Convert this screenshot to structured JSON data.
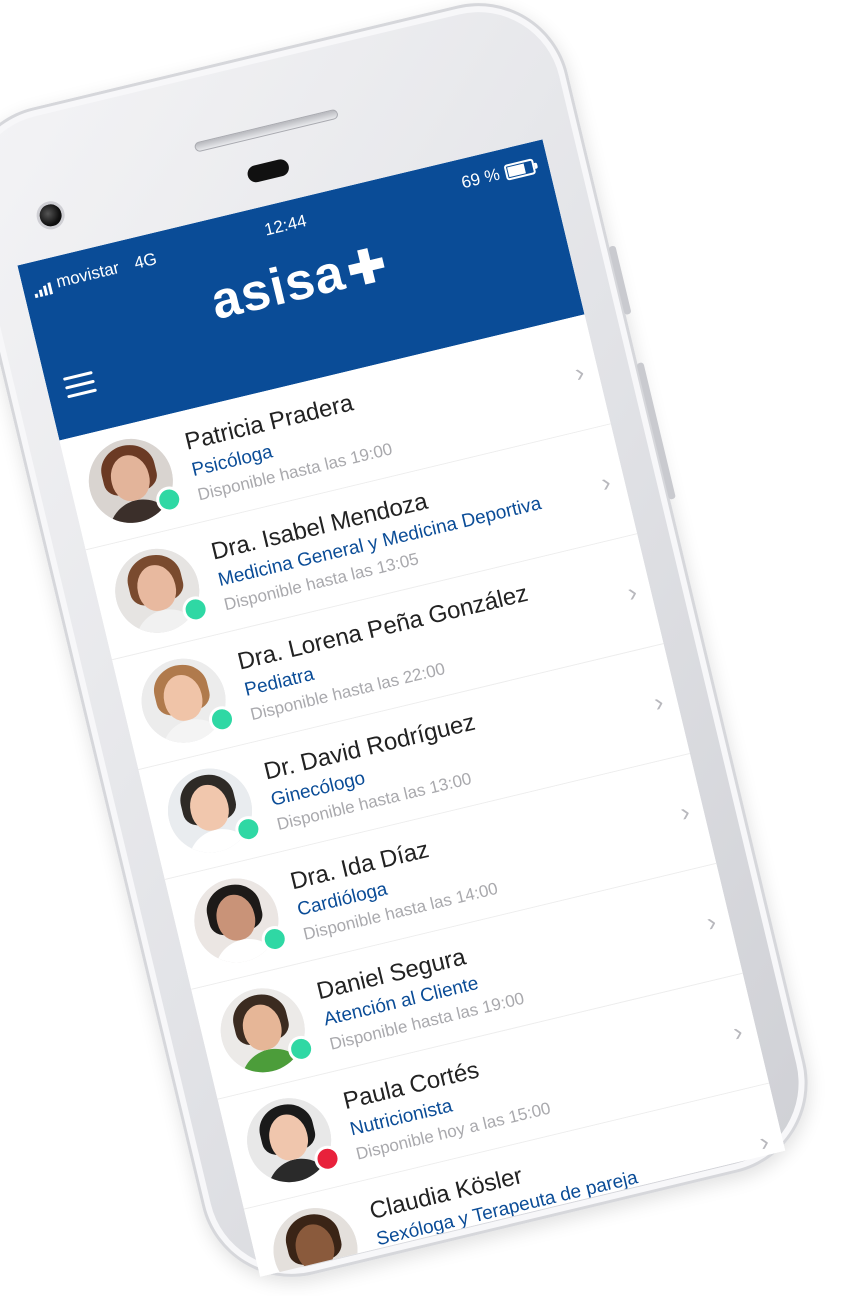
{
  "status_bar": {
    "carrier": "movistar",
    "network": "4G",
    "time": "12:44",
    "battery": "69 %"
  },
  "header": {
    "logo": "asisa",
    "logo_mark": "✚"
  },
  "colors": {
    "brand": "#0a4c97",
    "available": "#2fd8a4",
    "busy": "#e8213b"
  },
  "doctors": [
    {
      "name": "Patricia Pradera",
      "specialty": "Psicóloga",
      "availability": "Disponible hasta las 19:00",
      "status": "available"
    },
    {
      "name": "Dra. Isabel Mendoza",
      "specialty": "Medicina General y Medicina Deportiva",
      "availability": "Disponible hasta las 13:05",
      "status": "available"
    },
    {
      "name": "Dra. Lorena Peña González",
      "specialty": "Pediatra",
      "availability": "Disponible hasta las 22:00",
      "status": "available"
    },
    {
      "name": "Dr. David Rodríguez",
      "specialty": "Ginecólogo",
      "availability": "Disponible hasta las 13:00",
      "status": "available"
    },
    {
      "name": "Dra. Ida Díaz",
      "specialty": "Cardióloga",
      "availability": "Disponible hasta las 14:00",
      "status": "available"
    },
    {
      "name": "Daniel Segura",
      "specialty": "Atención al Cliente",
      "availability": "Disponible hasta las 19:00",
      "status": "available"
    },
    {
      "name": "Paula Cortés",
      "specialty": "Nutricionista",
      "availability": "Disponible hoy a las 15:00",
      "status": "busy"
    },
    {
      "name": "Claudia Kösler",
      "specialty": "Sexóloga y Terapeuta de pareja",
      "availability": "",
      "status": "available"
    }
  ]
}
